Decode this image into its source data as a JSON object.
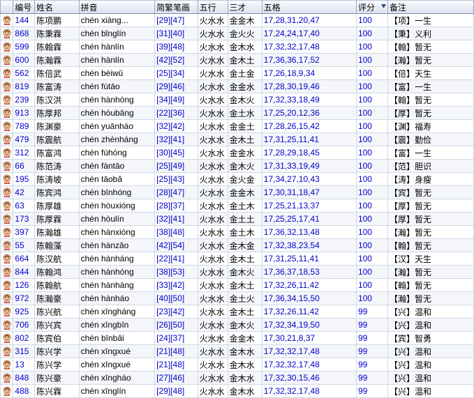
{
  "headers": {
    "icon": "",
    "no": "编号",
    "name": "姓名",
    "pinyin": "拼音",
    "strokes": "简繁笔画",
    "wuxing": "五行",
    "sancai": "三才",
    "wuge": "五格",
    "score": "评分",
    "remark": "备注"
  },
  "rows": [
    {
      "no": "144",
      "name": "陈项鹏",
      "pinyin": "chén xiàng...",
      "strokes": "[29][47]",
      "wuxing": "火水水",
      "sancai": "金金木",
      "wuge": "17,28,31,20,47",
      "score": "100",
      "remark": "【项】一生"
    },
    {
      "no": "868",
      "name": "陈秉霖",
      "pinyin": "chén bǐnglín",
      "strokes": "[31][40]",
      "wuxing": "火水水",
      "sancai": "金火火",
      "wuge": "17,24,24,17,40",
      "score": "100",
      "remark": "【秉】义利"
    },
    {
      "no": "599",
      "name": "陈翰霖",
      "pinyin": "chén hànlín",
      "strokes": "[39][48]",
      "wuxing": "火水水",
      "sancai": "金木水",
      "wuge": "17,32,32,17,48",
      "score": "100",
      "remark": "【翰】暂无"
    },
    {
      "no": "600",
      "name": "陈瀚霖",
      "pinyin": "chén hànlín",
      "strokes": "[42][52]",
      "wuxing": "火水水",
      "sancai": "金木土",
      "wuge": "17,36,36,17,52",
      "score": "100",
      "remark": "【瀚】暂无"
    },
    {
      "no": "562",
      "name": "陈倍武",
      "pinyin": "chén bèiwǔ",
      "strokes": "[25][34]",
      "wuxing": "火水水",
      "sancai": "金土金",
      "wuge": "17,26,18,9,34",
      "score": "100",
      "remark": "【倍】天生"
    },
    {
      "no": "819",
      "name": "陈富涛",
      "pinyin": "chén fùtāo",
      "strokes": "[29][46]",
      "wuxing": "火水水",
      "sancai": "金金水",
      "wuge": "17,28,30,19,46",
      "score": "100",
      "remark": "【富】一生"
    },
    {
      "no": "239",
      "name": "陈汉洪",
      "pinyin": "chén hànhóng",
      "strokes": "[34][49]",
      "wuxing": "火水水",
      "sancai": "金木火",
      "wuge": "17,32,33,18,49",
      "score": "100",
      "remark": "【翰】暂无"
    },
    {
      "no": "913",
      "name": "陈厚邦",
      "pinyin": "chén hòubāng",
      "strokes": "[22][36]",
      "wuxing": "火水水",
      "sancai": "金土水",
      "wuge": "17,25,20,12,36",
      "score": "100",
      "remark": "【厚】暂无"
    },
    {
      "no": "789",
      "name": "陈渊豪",
      "pinyin": "chén yuānháo",
      "strokes": "[32][42]",
      "wuxing": "火水水",
      "sancai": "金金土",
      "wuge": "17,28,26,15,42",
      "score": "100",
      "remark": "【渊】福寿"
    },
    {
      "no": "479",
      "name": "陈震航",
      "pinyin": "chén zhènháng",
      "strokes": "[32][41]",
      "wuxing": "火水水",
      "sancai": "金木土",
      "wuge": "17,31,25,11,41",
      "score": "100",
      "remark": "【震】勤俭"
    },
    {
      "no": "312",
      "name": "陈富鸿",
      "pinyin": "chén fùhóng",
      "strokes": "[30][45]",
      "wuxing": "火水水",
      "sancai": "金金水",
      "wuge": "17,28,29,18,45",
      "score": "100",
      "remark": "【富】一生"
    },
    {
      "no": "66",
      "name": "陈范涛",
      "pinyin": "chén fàntāo",
      "strokes": "[25][49]",
      "wuxing": "火水水",
      "sancai": "金木火",
      "wuge": "17,31,33,19,49",
      "score": "100",
      "remark": "【范】胆识"
    },
    {
      "no": "195",
      "name": "陈涛坡",
      "pinyin": "chén tāobǎ",
      "strokes": "[25][43]",
      "wuxing": "火水水",
      "sancai": "金火金",
      "wuge": "17,34,27,10,43",
      "score": "100",
      "remark": "【涛】身瘦"
    },
    {
      "no": "42",
      "name": "陈宾鸿",
      "pinyin": "chén bīnhóng",
      "strokes": "[28][47]",
      "wuxing": "火水水",
      "sancai": "金金木",
      "wuge": "17,30,31,18,47",
      "score": "100",
      "remark": "【宾】暂无"
    },
    {
      "no": "63",
      "name": "陈厚雄",
      "pinyin": "chén hòuxióng",
      "strokes": "[28][37]",
      "wuxing": "火水水",
      "sancai": "金土木",
      "wuge": "17,25,21,13,37",
      "score": "100",
      "remark": "【厚】暂无"
    },
    {
      "no": "173",
      "name": "陈厚霖",
      "pinyin": "chén hòulín",
      "strokes": "[32][41]",
      "wuxing": "火水水",
      "sancai": "金土土",
      "wuge": "17,25,25,17,41",
      "score": "100",
      "remark": "【厚】暂无"
    },
    {
      "no": "397",
      "name": "陈瀚雄",
      "pinyin": "chén hànxióng",
      "strokes": "[38][48]",
      "wuxing": "火水水",
      "sancai": "金土木",
      "wuge": "17,36,32,13,48",
      "score": "100",
      "remark": "【瀚】暂无"
    },
    {
      "no": "55",
      "name": "陈翰藻",
      "pinyin": "chén hànzǎo",
      "strokes": "[42][54]",
      "wuxing": "火水水",
      "sancai": "金木金",
      "wuge": "17,32,38,23,54",
      "score": "100",
      "remark": "【翰】暂无"
    },
    {
      "no": "664",
      "name": "陈汉航",
      "pinyin": "chén hànháng",
      "strokes": "[22][41]",
      "wuxing": "火水水",
      "sancai": "金木土",
      "wuge": "17,31,25,11,41",
      "score": "100",
      "remark": "【汉】天生"
    },
    {
      "no": "844",
      "name": "陈翰鸿",
      "pinyin": "chén hànhóng",
      "strokes": "[38][53]",
      "wuxing": "火水水",
      "sancai": "金木火",
      "wuge": "17,36,37,18,53",
      "score": "100",
      "remark": "【瀚】暂无"
    },
    {
      "no": "126",
      "name": "陈翰航",
      "pinyin": "chén hànháng",
      "strokes": "[33][42]",
      "wuxing": "火水水",
      "sancai": "金木土",
      "wuge": "17,32,26,11,42",
      "score": "100",
      "remark": "【翰】暂无"
    },
    {
      "no": "972",
      "name": "陈瀚豪",
      "pinyin": "chén hànháo",
      "strokes": "[40][50]",
      "wuxing": "火水水",
      "sancai": "金土火",
      "wuge": "17,36,34,15,50",
      "score": "100",
      "remark": "【瀚】暂无"
    },
    {
      "no": "925",
      "name": "陈兴航",
      "pinyin": "chén xīngháng",
      "strokes": "[23][42]",
      "wuxing": "火水水",
      "sancai": "金木土",
      "wuge": "17,32,26,11,42",
      "score": "99",
      "remark": "【兴】温和"
    },
    {
      "no": "706",
      "name": "陈兴宾",
      "pinyin": "chén xīngbīn",
      "strokes": "[26][50]",
      "wuxing": "火水水",
      "sancai": "金木火",
      "wuge": "17,32,34,19,50",
      "score": "99",
      "remark": "【兴】温和"
    },
    {
      "no": "802",
      "name": "陈宾伯",
      "pinyin": "chén bīnbǎi",
      "strokes": "[24][37]",
      "wuxing": "火水水",
      "sancai": "金金木",
      "wuge": "17,30,21,8,37",
      "score": "99",
      "remark": "【宾】智勇"
    },
    {
      "no": "315",
      "name": "陈兴学",
      "pinyin": "chén xīngxué",
      "strokes": "[21][48]",
      "wuxing": "火水水",
      "sancai": "金木水",
      "wuge": "17,32,32,17,48",
      "score": "99",
      "remark": "【兴】温和"
    },
    {
      "no": "13",
      "name": "陈兴学",
      "pinyin": "chén xīngxué",
      "strokes": "[21][48]",
      "wuxing": "火水水",
      "sancai": "金木水",
      "wuge": "17,32,32,17,48",
      "score": "99",
      "remark": "【兴】温和"
    },
    {
      "no": "848",
      "name": "陈兴豪",
      "pinyin": "chén xīngháo",
      "strokes": "[27][46]",
      "wuxing": "火水水",
      "sancai": "金木水",
      "wuge": "17,32,30,15,46",
      "score": "99",
      "remark": "【兴】温和"
    },
    {
      "no": "488",
      "name": "陈兴霖",
      "pinyin": "chén xīnglín",
      "strokes": "[29][48]",
      "wuxing": "火水水",
      "sancai": "金木水",
      "wuge": "17,32,32,17,48",
      "score": "99",
      "remark": "【兴】温和"
    }
  ]
}
